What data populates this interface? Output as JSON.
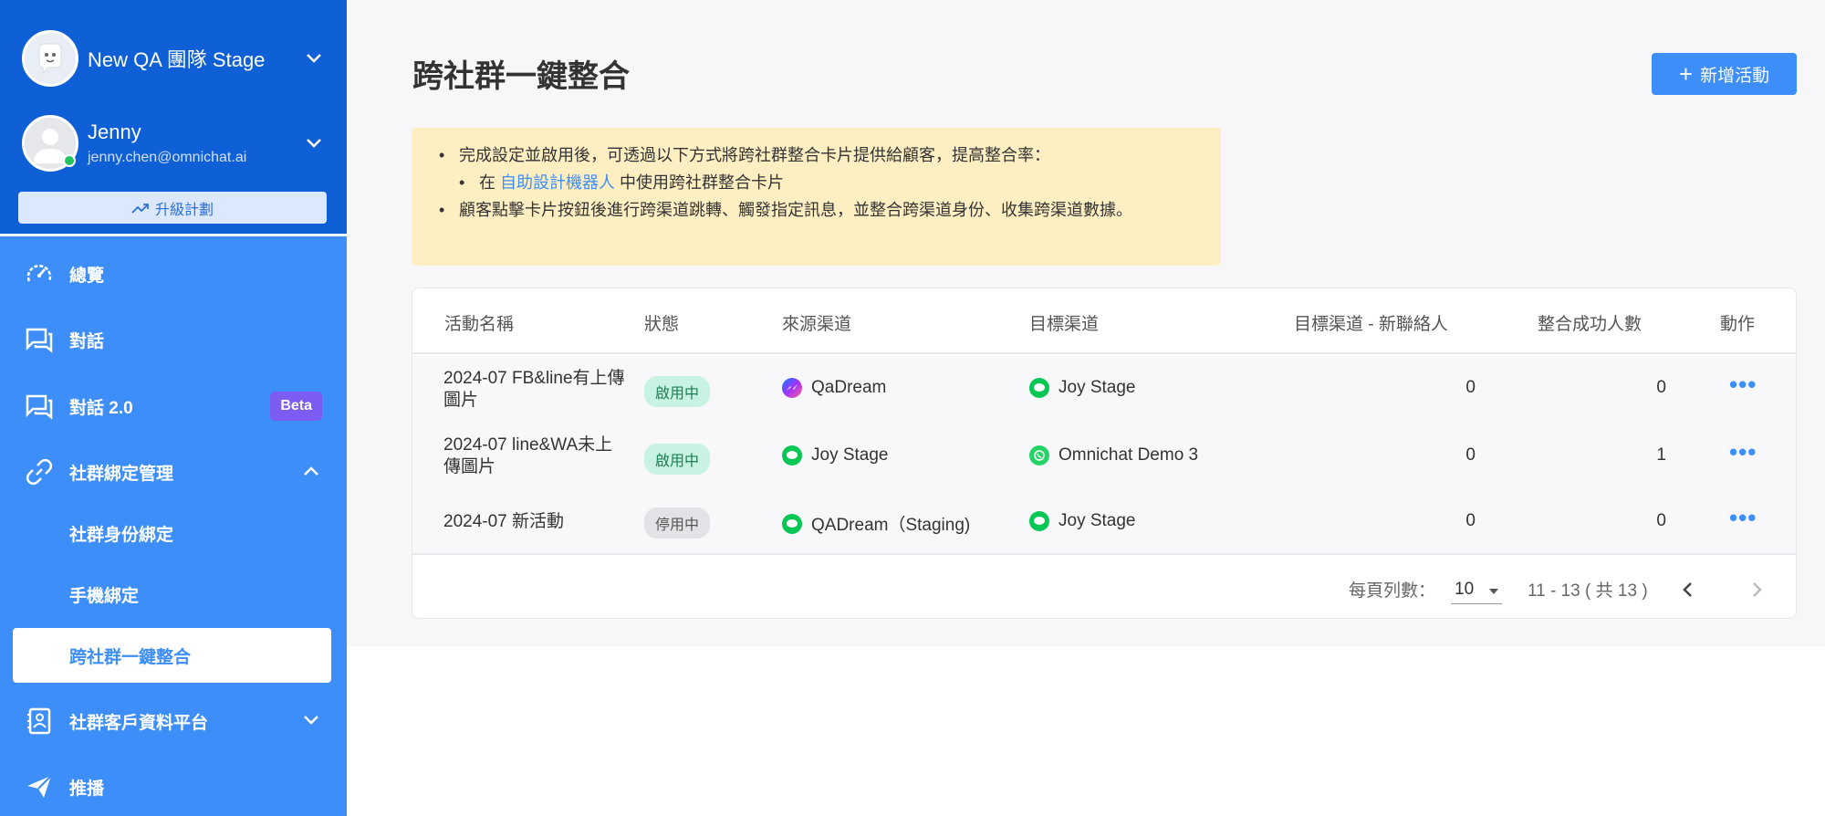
{
  "sidebar": {
    "team_name": "New QA 團隊 Stage",
    "user_name": "Jenny",
    "user_email": "jenny.chen@omnichat.ai",
    "upgrade_label": "升級計劃",
    "nav": [
      {
        "label": "總覽",
        "icon": "dashboard-gauge-icon"
      },
      {
        "label": "對話",
        "icon": "chat-bubble-icon"
      },
      {
        "label": "對話 2.0",
        "icon": "chat-bubble-icon",
        "badge": "Beta"
      },
      {
        "label": "社群綁定管理",
        "icon": "link-icon",
        "expanded": true
      },
      {
        "label": "社群客戶資料平台",
        "icon": "contact-book-icon"
      },
      {
        "label": "推播",
        "icon": "paper-plane-icon"
      }
    ],
    "sub_items": [
      "社群身份綁定",
      "手機綁定",
      "跨社群一鍵整合"
    ],
    "active_sub": "跨社群一鍵整合"
  },
  "header": {
    "title": "跨社群一鍵整合",
    "add_button_label": "新增活動"
  },
  "notice": {
    "line1": "完成設定並啟用後，可透過以下方式將跨社群整合卡片提供給顧客，提高整合率：",
    "sub_prefix": "在",
    "sub_link": "自助設計機器人",
    "sub_suffix": "中使用跨社群整合卡片",
    "line2": "顧客點擊卡片按鈕後進行跨渠道跳轉、觸發指定訊息，並整合跨渠道身份、收集跨渠道數據。"
  },
  "table": {
    "columns": [
      "活動名稱",
      "狀態",
      "來源渠道",
      "目標渠道",
      "目標渠道 - 新聯絡人",
      "整合成功人數",
      "動作"
    ],
    "rows": [
      {
        "name": "2024-07 FB&line有上傳圖片",
        "status": "啟用中",
        "status_type": "on",
        "source": "QaDream",
        "source_icon": "messenger-icon",
        "target": "Joy Stage",
        "target_icon": "line-icon",
        "new_contacts": "0",
        "merged": "0"
      },
      {
        "name": "2024-07 line&WA未上傳圖片",
        "status": "啟用中",
        "status_type": "on",
        "source": "Joy Stage",
        "source_icon": "line-icon",
        "target": "Omnichat Demo 3",
        "target_icon": "whatsapp-icon",
        "new_contacts": "0",
        "merged": "1"
      },
      {
        "name": "2024-07 新活動",
        "status": "停用中",
        "status_type": "off",
        "source": "QADream（Staging)",
        "source_icon": "line-icon",
        "target": "Joy Stage",
        "target_icon": "line-icon",
        "new_contacts": "0",
        "merged": "0"
      }
    ],
    "more_label": "•••"
  },
  "pagination": {
    "rows_per_page_label": "每頁列數：",
    "rows_per_page": "10",
    "range_label": "11 - 13 ( 共 13 )"
  },
  "colors": {
    "sidebar": "#3d8ef8",
    "sidebar_top": "#0f5fd6",
    "accent": "#3d8ef8",
    "beta": "#7c5cf2",
    "line_green": "#06c755",
    "whatsapp_green": "#25d366",
    "notice_bg": "#feefc3"
  }
}
